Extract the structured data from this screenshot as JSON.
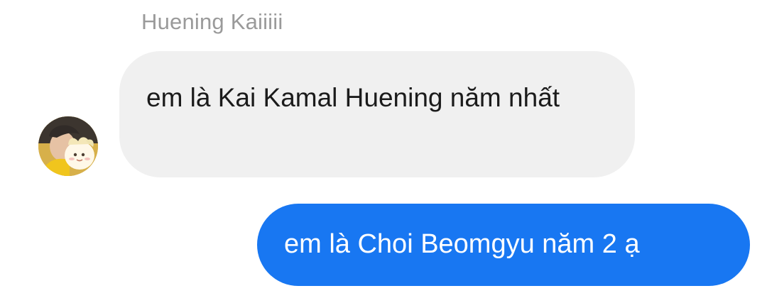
{
  "thread": {
    "sender_name": "Huening Kaiiiii",
    "incoming_message": "em là Kai Kamal Huening năm nhất",
    "outgoing_message": "em là Choi Beomgyu năm 2 ạ"
  },
  "colors": {
    "background": "#ffffff",
    "incoming_bubble": "#f0f0f0",
    "outgoing_bubble": "#1877f2",
    "sender_name_text": "#9a9a9a"
  },
  "icons": {
    "avatar": "profile-photo-avatar"
  }
}
